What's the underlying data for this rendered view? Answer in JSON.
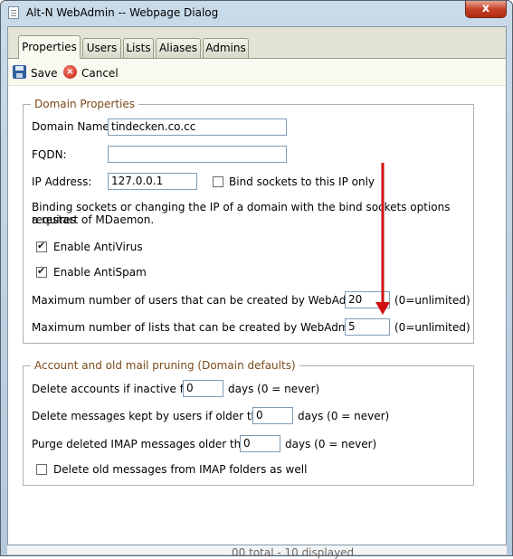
{
  "window": {
    "title": "Alt-N WebAdmin -- Webpage Dialog",
    "close_glyph": "x",
    "background_text": "00 total - 10 displayed"
  },
  "tabs": [
    {
      "label": "Properties",
      "active": true
    },
    {
      "label": "Users",
      "active": false
    },
    {
      "label": "Lists",
      "active": false
    },
    {
      "label": "Aliases",
      "active": false
    },
    {
      "label": "Admins",
      "active": false
    }
  ],
  "toolbar": {
    "save_label": "Save",
    "cancel_label": "Cancel",
    "cancel_glyph": "×"
  },
  "domain_properties": {
    "legend": "Domain Properties",
    "domain_name_label": "Domain Name:",
    "domain_name_value": "tindecken.co.cc",
    "fqdn_label": "FQDN:",
    "fqdn_value": "",
    "ip_label": "IP Address:",
    "ip_value": "127.0.0.1",
    "bind_sockets_label": "Bind sockets to this IP only",
    "bind_sockets_checked": false,
    "note_line1": "Binding sockets or changing the IP of a domain with the bind sockets options requires",
    "note_line2": "a restart of MDaemon.",
    "antivirus_label": "Enable AntiVirus",
    "antivirus_checked": true,
    "antispam_label": "Enable AntiSpam",
    "antispam_checked": true,
    "max_users_label": "Maximum number of users that can be created by WebAdmin:",
    "max_users_value": "20",
    "max_users_hint": "(0=unlimited)",
    "max_lists_label": "Maximum number of lists that can be created by WebAdmin:",
    "max_lists_value": "5",
    "max_lists_hint": "(0=unlimited)"
  },
  "pruning": {
    "legend": "Account and old mail pruning (Domain defaults)",
    "inactive_label": "Delete accounts if inactive for",
    "inactive_value": "0",
    "inactive_hint": "days (0 = never)",
    "old_msgs_label": "Delete messages kept by users if older than",
    "old_msgs_value": "0",
    "old_msgs_hint": "days (0 = never)",
    "purge_label": "Purge deleted IMAP messages older than",
    "purge_value": "0",
    "purge_hint": "days (0 = never)",
    "delete_imap_label": "Delete old messages from IMAP folders as well",
    "delete_imap_checked": false
  },
  "colors": {
    "annotation_arrow": "#d01010",
    "legend_text": "#7a4a1a"
  }
}
